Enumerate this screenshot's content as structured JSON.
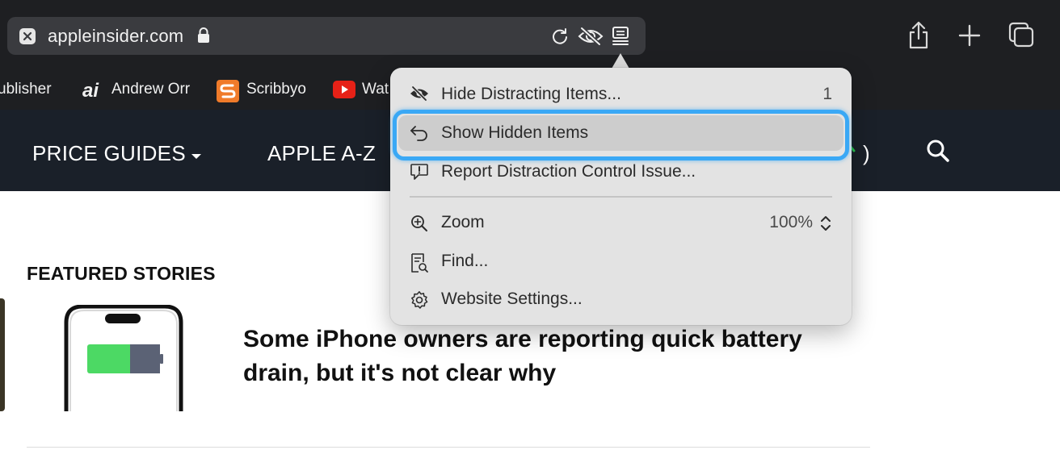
{
  "browser": {
    "url": "appleinsider.com",
    "icons": {
      "tab_close": "close-icon",
      "lock": "lock-icon",
      "reload": "reload-icon",
      "hide_distractions": "eye-slash-icon",
      "page_menu": "page-menu-icon",
      "share": "share-icon",
      "new_tab": "plus-icon",
      "tab_overview": "tabs-overview-icon"
    }
  },
  "bookmarks": [
    {
      "label": "ublisher"
    },
    {
      "label": "Andrew Orr",
      "icon": "ai-logo-icon"
    },
    {
      "label": "Scribbyo",
      "icon": "scribbyo-logo-icon"
    },
    {
      "label": "Wat",
      "icon": "youtube-logo-icon"
    }
  ],
  "site_nav": {
    "links": [
      "PRICE GUIDES",
      "APPLE A-Z"
    ],
    "paren": ")"
  },
  "featured": {
    "section_title": "FEATURED STORIES",
    "headline": "Some iPhone owners are reporting quick battery drain, but it's not clear why"
  },
  "menu": {
    "items": [
      {
        "label": "Hide Distracting Items...",
        "value": "1",
        "icon": "eye-slash-icon"
      },
      {
        "label": "Show Hidden Items",
        "icon": "undo-arrow-icon",
        "highlighted": true
      },
      {
        "label": "Report Distraction Control Issue...",
        "icon": "report-bubble-icon"
      },
      {
        "label": "Zoom",
        "value": "100%",
        "icon": "zoom-in-icon"
      },
      {
        "label": "Find...",
        "icon": "find-doc-icon"
      },
      {
        "label": "Website Settings...",
        "icon": "gear-icon"
      }
    ]
  },
  "colors": {
    "toolbar_bg": "#1e1f22",
    "address_bar_bg": "#3a3b3f",
    "site_nav_bg": "#1a2029",
    "menu_bg": "#e3e3e3",
    "highlight_ring": "#3aa8f5",
    "battery_green": "#4cd964",
    "battery_gray": "#5b6275"
  }
}
